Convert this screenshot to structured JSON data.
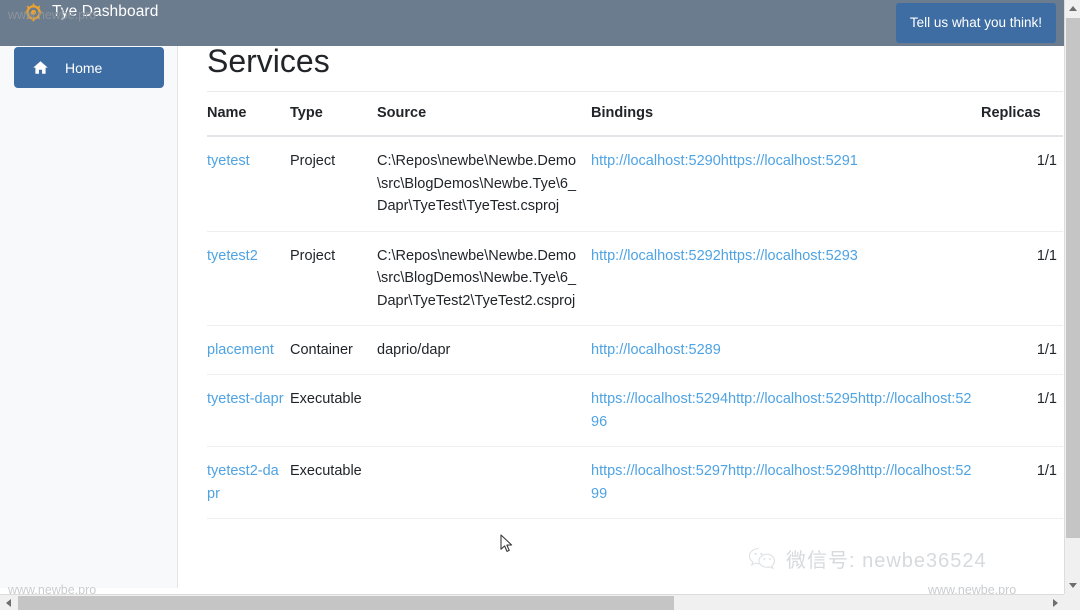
{
  "topbar": {
    "brand_title": "Tye Dashboard",
    "brand_icon": "gear-icon",
    "feedback_label": "Tell us what you think!",
    "bg_color": "#6b7c8e",
    "accent_color": "#3d6da3"
  },
  "sidebar": {
    "items": [
      {
        "label": "Home",
        "icon": "home-icon",
        "active": true
      }
    ]
  },
  "main": {
    "page_title": "Services",
    "table": {
      "columns": [
        "Name",
        "Type",
        "Source",
        "Bindings",
        "Replicas"
      ],
      "rows": [
        {
          "name": "tyetest",
          "type": "Project",
          "source": "C:\\Repos\\newbe\\Newbe.Demo\\src\\BlogDemos\\Newbe.Tye\\6_Dapr\\TyeTest\\TyeTest.csproj",
          "bindings": [
            "http://localhost:5290",
            "https://localhost:5291"
          ],
          "replicas": "1/1"
        },
        {
          "name": "tyetest2",
          "type": "Project",
          "source": "C:\\Repos\\newbe\\Newbe.Demo\\src\\BlogDemos\\Newbe.Tye\\6_Dapr\\TyeTest2\\TyeTest2.csproj",
          "bindings": [
            "http://localhost:5292",
            "https://localhost:5293"
          ],
          "replicas": "1/1"
        },
        {
          "name": "placement",
          "type": "Container",
          "source": "daprio/dapr",
          "bindings": [
            "http://localhost:5289"
          ],
          "replicas": "1/1"
        },
        {
          "name": "tyetest-dapr",
          "type": "Executable",
          "source": "",
          "bindings": [
            "https://localhost:5294",
            "http://localhost:5295",
            "http://localhost:5296"
          ],
          "replicas": "1/1"
        },
        {
          "name": "tyetest2-dapr",
          "type": "Executable",
          "source": "",
          "bindings": [
            "https://localhost:5297",
            "http://localhost:5298",
            "http://localhost:5299"
          ],
          "replicas": "1/1"
        }
      ]
    },
    "link_color": "#4fa3e3"
  },
  "watermarks": {
    "top_left": "www.newbe.pro",
    "bottom_left": "www.newbe.pro",
    "bottom_right": "www.newbe.pro",
    "wechat_text": "微信号: newbe36524",
    "wechat_icon": "wechat-icon"
  },
  "scrollbars": {
    "vertical_arrow_up": "triangle-up-icon",
    "vertical_arrow_down": "triangle-down-icon",
    "horizontal_arrow_left": "triangle-left-icon",
    "horizontal_arrow_right": "triangle-right-icon"
  }
}
